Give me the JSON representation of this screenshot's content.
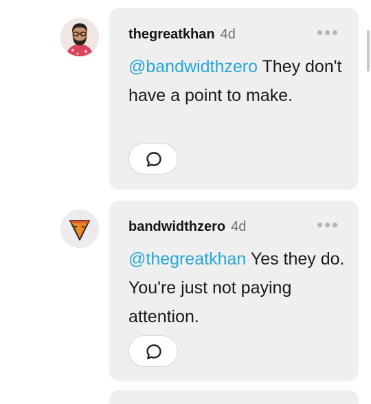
{
  "replies": [
    {
      "username": "thegreatkhan",
      "time": "4d",
      "mention": "@bandwidthzero",
      "text": " They don't have a point to make.",
      "avatar_icon": "bearded-man-avatar",
      "reply_icon": "speech-bubble-icon",
      "more_icon": "ellipsis-icon"
    },
    {
      "username": "bandwidthzero",
      "time": "4d",
      "mention": "@thegreatkhan",
      "text": " Yes they do. You're just not paying attention.",
      "avatar_icon": "orange-triangle-face-avatar",
      "reply_icon": "speech-bubble-icon",
      "more_icon": "ellipsis-icon"
    }
  ],
  "colors": {
    "mention": "#26a6d8",
    "card_background": "#efefef",
    "username": "#141414",
    "timestamp": "#6f6f6f"
  }
}
